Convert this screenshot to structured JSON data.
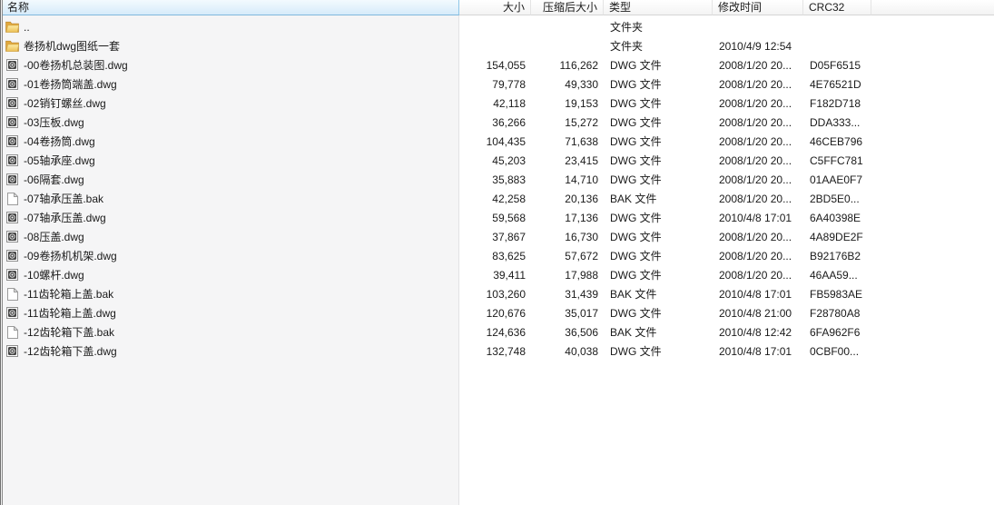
{
  "app": {
    "kind": "archive-file-list",
    "language": "zh-CN"
  },
  "colors": {
    "sorted_header_bg_top": "#f3fafe",
    "sorted_header_bg_bottom": "#d6ebfa",
    "sorted_header_border": "#7fb8dd",
    "sorted_column_shade": "#f5f5f6",
    "header_bg": "#f3f3f3",
    "header_border": "#d5d5d5",
    "row_text": "#1a1a1a",
    "folder_icon_color": "#f0c860",
    "background": "#ffffff"
  },
  "list": {
    "columns": [
      {
        "id": "name",
        "label": "名称",
        "align": "left",
        "sorted": true
      },
      {
        "id": "size",
        "label": "大小",
        "align": "right",
        "sorted": false
      },
      {
        "id": "packed",
        "label": "压缩后大小",
        "align": "right",
        "sorted": false
      },
      {
        "id": "type",
        "label": "类型",
        "align": "left",
        "sorted": false
      },
      {
        "id": "modified",
        "label": "修改时间",
        "align": "left",
        "sorted": false
      },
      {
        "id": "crc",
        "label": "CRC32",
        "align": "left",
        "sorted": false
      }
    ],
    "rows": [
      {
        "icon": "folder",
        "name": "..",
        "size": "",
        "packed": "",
        "type": "文件夹",
        "modified": "",
        "crc": ""
      },
      {
        "icon": "folder",
        "name": "卷扬机dwg图纸一套",
        "size": "",
        "packed": "",
        "type": "文件夹",
        "modified": "2010/4/9 12:54",
        "crc": ""
      },
      {
        "icon": "dwg",
        "name": "-00卷扬机总装图.dwg",
        "size": "154,055",
        "packed": "116,262",
        "type": "DWG 文件",
        "modified": "2008/1/20 20...",
        "crc": "D05F6515"
      },
      {
        "icon": "dwg",
        "name": "-01卷扬筒端盖.dwg",
        "size": "79,778",
        "packed": "49,330",
        "type": "DWG 文件",
        "modified": "2008/1/20 20...",
        "crc": "4E76521D"
      },
      {
        "icon": "dwg",
        "name": "-02销钉螺丝.dwg",
        "size": "42,118",
        "packed": "19,153",
        "type": "DWG 文件",
        "modified": "2008/1/20 20...",
        "crc": "F182D718"
      },
      {
        "icon": "dwg",
        "name": "-03压板.dwg",
        "size": "36,266",
        "packed": "15,272",
        "type": "DWG 文件",
        "modified": "2008/1/20 20...",
        "crc": "DDA333..."
      },
      {
        "icon": "dwg",
        "name": "-04卷扬筒.dwg",
        "size": "104,435",
        "packed": "71,638",
        "type": "DWG 文件",
        "modified": "2008/1/20 20...",
        "crc": "46CEB796"
      },
      {
        "icon": "dwg",
        "name": "-05轴承座.dwg",
        "size": "45,203",
        "packed": "23,415",
        "type": "DWG 文件",
        "modified": "2008/1/20 20...",
        "crc": "C5FFC781"
      },
      {
        "icon": "dwg",
        "name": "-06隔套.dwg",
        "size": "35,883",
        "packed": "14,710",
        "type": "DWG 文件",
        "modified": "2008/1/20 20...",
        "crc": "01AAE0F7"
      },
      {
        "icon": "bak",
        "name": "-07轴承压盖.bak",
        "size": "42,258",
        "packed": "20,136",
        "type": "BAK 文件",
        "modified": "2008/1/20 20...",
        "crc": "2BD5E0..."
      },
      {
        "icon": "dwg",
        "name": "-07轴承压盖.dwg",
        "size": "59,568",
        "packed": "17,136",
        "type": "DWG 文件",
        "modified": "2010/4/8 17:01",
        "crc": "6A40398E"
      },
      {
        "icon": "dwg",
        "name": "-08压盖.dwg",
        "size": "37,867",
        "packed": "16,730",
        "type": "DWG 文件",
        "modified": "2008/1/20 20...",
        "crc": "4A89DE2F"
      },
      {
        "icon": "dwg",
        "name": "-09卷扬机机架.dwg",
        "size": "83,625",
        "packed": "57,672",
        "type": "DWG 文件",
        "modified": "2008/1/20 20...",
        "crc": "B92176B2"
      },
      {
        "icon": "dwg",
        "name": "-10螺杆.dwg",
        "size": "39,411",
        "packed": "17,988",
        "type": "DWG 文件",
        "modified": "2008/1/20 20...",
        "crc": "46AA59..."
      },
      {
        "icon": "bak",
        "name": "-11齿轮箱上盖.bak",
        "size": "103,260",
        "packed": "31,439",
        "type": "BAK 文件",
        "modified": "2010/4/8 17:01",
        "crc": "FB5983AE"
      },
      {
        "icon": "dwg",
        "name": "-11齿轮箱上盖.dwg",
        "size": "120,676",
        "packed": "35,017",
        "type": "DWG 文件",
        "modified": "2010/4/8 21:00",
        "crc": "F28780A8"
      },
      {
        "icon": "bak",
        "name": "-12齿轮箱下盖.bak",
        "size": "124,636",
        "packed": "36,506",
        "type": "BAK 文件",
        "modified": "2010/4/8 12:42",
        "crc": "6FA962F6"
      },
      {
        "icon": "dwg",
        "name": "-12齿轮箱下盖.dwg",
        "size": "132,748",
        "packed": "40,038",
        "type": "DWG 文件",
        "modified": "2010/4/8 17:01",
        "crc": "0CBF00..."
      }
    ]
  }
}
